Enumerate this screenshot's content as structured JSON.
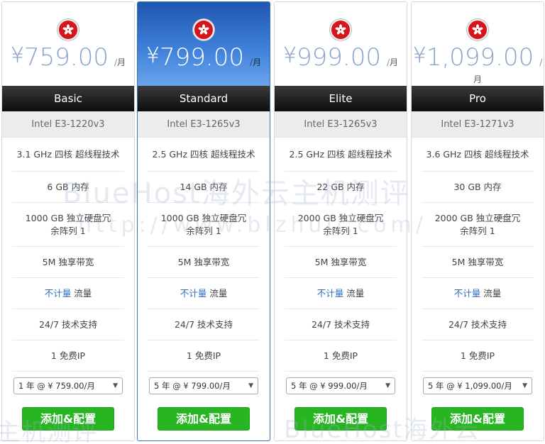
{
  "colors": {
    "accent_blue": "#2f6fc2",
    "flag_red": "#d4151d",
    "button_green": "#27b522",
    "header_black": "#111111"
  },
  "plans": [
    {
      "price": {
        "currency": "¥",
        "amount": "759.00",
        "unit": "/月"
      },
      "name": "Basic",
      "cpu": "Intel E3-1220v3",
      "features": [
        "3.1 GHz 四核 超线程技术",
        "6 GB 内存",
        "1000 GB 独立硬盘冗余阵列 1",
        "5M 独享带宽"
      ],
      "bandwidth": {
        "highlight": "不计量",
        "label": "流量"
      },
      "support": "24/7 技术支持",
      "ip": "1 免费IP",
      "cycle": "1 年 @ ¥ 759.00/月",
      "order_label": "添加&配置"
    },
    {
      "price": {
        "currency": "¥",
        "amount": "799.00",
        "unit": "/月"
      },
      "name": "Standard",
      "cpu": "Intel E3-1265v3",
      "features": [
        "2.5 GHz 四核 超线程技术",
        "14 GB 内存",
        "1000 GB 独立硬盘冗余阵列 1",
        "5M 独享带宽"
      ],
      "bandwidth": {
        "highlight": "不计量",
        "label": "流量"
      },
      "support": "24/7 技术支持",
      "ip": "1 免费IP",
      "cycle": "5 年 @ ¥ 799.00/月",
      "order_label": "添加&配置"
    },
    {
      "price": {
        "currency": "¥",
        "amount": "999.00",
        "unit": "/月"
      },
      "name": "Elite",
      "cpu": "Intel E3-1265v3",
      "features": [
        "2.5 GHz 四核 超线程技术",
        "22 GB 内存",
        "2000 GB 独立硬盘冗余阵列 1",
        "5M 独享带宽"
      ],
      "bandwidth": {
        "highlight": "不计量",
        "label": "流量"
      },
      "support": "24/7 技术支持",
      "ip": "1 免费IP",
      "cycle": "5 年 @ ¥ 999.00/月",
      "order_label": "添加&配置"
    },
    {
      "price": {
        "currency": "¥",
        "amount": "1,099.00",
        "unit": "/月"
      },
      "name": "Pro",
      "cpu": "Intel E3-1271v3",
      "features": [
        "3.6 GHz 四核 超线程技术",
        "30 GB 内存",
        "2000 GB 独立硬盘冗余阵列 1",
        "5M 独享带宽"
      ],
      "bandwidth": {
        "highlight": "不计量",
        "label": "流量"
      },
      "support": "24/7 技术支持",
      "ip": "1 免费IP",
      "cycle": "5 年 @ ¥ 1,099.00/月",
      "order_label": "添加&配置"
    }
  ],
  "watermark": {
    "line1": "BlueHost海外云主机测评",
    "line2": "http://www.blzhuji.com/",
    "line3": "BlueHost海外云",
    "line4": "主机测评"
  }
}
